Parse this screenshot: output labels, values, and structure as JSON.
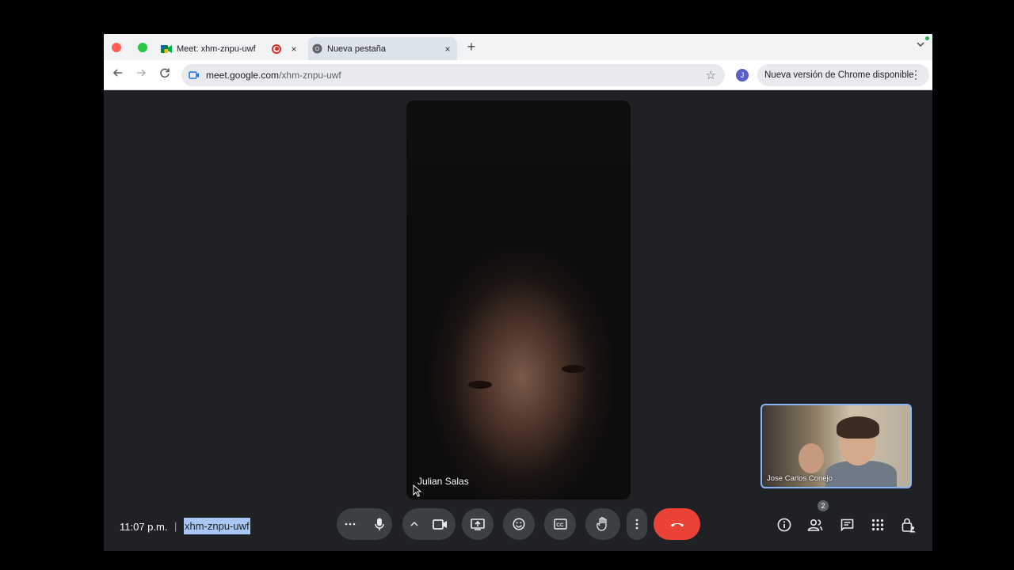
{
  "browser": {
    "tabs": [
      {
        "label": "Meet: xhm-znpu-uwf",
        "close": "×"
      },
      {
        "label": "Nueva pestaña",
        "close": "×"
      }
    ],
    "new_tab": "+",
    "tab_dropdown": "⌄",
    "address": {
      "host": "meet.google.com",
      "path": "/xhm-znpu-uwf"
    },
    "profile_initial": "J",
    "update_label": "Nueva versión de Chrome disponible",
    "more": "⋮"
  },
  "meet": {
    "main_participant": "Julian Salas",
    "pip_participant": "Jose Carlos Conejo",
    "clock": "11:07 p.m.",
    "separator": "|",
    "meeting_code": "xhm-znpu-uwf",
    "participants_count": "2"
  },
  "colors": {
    "accent": "#8ab4f8",
    "end_call": "#ea4335",
    "recording": "#d93025"
  }
}
